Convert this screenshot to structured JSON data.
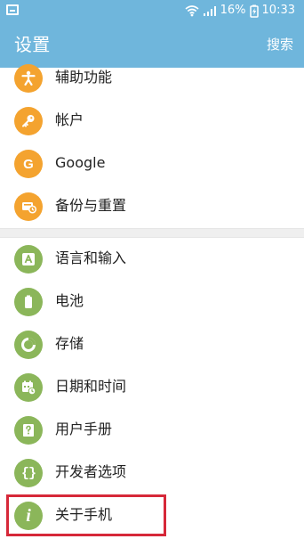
{
  "status_bar": {
    "battery": "16%",
    "time": "10:33"
  },
  "header": {
    "title": "设置",
    "search_label": "搜索"
  },
  "settings_items": [
    {
      "label": "辅助功能",
      "icon": "accessibility-icon",
      "color": "#f4a32f"
    },
    {
      "label": "帐户",
      "icon": "key-icon",
      "color": "#f4a32f"
    },
    {
      "label": "Google",
      "icon": "google-icon",
      "color": "#f4a32f"
    },
    {
      "label": "备份与重置",
      "icon": "backup-reset-icon",
      "color": "#f4a32f"
    },
    {
      "label": "语言和输入",
      "icon": "language-input-icon",
      "color": "#8bb65a"
    },
    {
      "label": "电池",
      "icon": "battery-icon",
      "color": "#8bb65a"
    },
    {
      "label": "存储",
      "icon": "storage-icon",
      "color": "#8bb65a"
    },
    {
      "label": "日期和时间",
      "icon": "date-time-icon",
      "color": "#8bb65a"
    },
    {
      "label": "用户手册",
      "icon": "user-manual-icon",
      "color": "#8bb65a"
    },
    {
      "label": "开发者选项",
      "icon": "developer-options-icon",
      "color": "#8bb65a"
    },
    {
      "label": "关于手机",
      "icon": "about-phone-icon",
      "color": "#8bb65a"
    }
  ],
  "colors": {
    "header_blue": "#6fb6dc",
    "orange_icon": "#f4a32f",
    "green_icon": "#8bb65a",
    "highlight_red": "#d62839"
  }
}
